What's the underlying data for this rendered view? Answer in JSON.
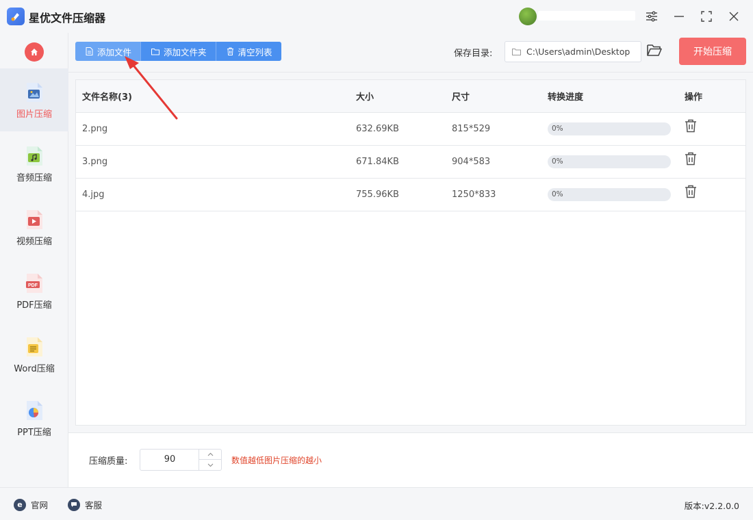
{
  "app": {
    "title": "星优文件压缩器"
  },
  "sidebar": {
    "items": [
      {
        "label": "图片压缩",
        "icon": "image-file-icon",
        "active": true
      },
      {
        "label": "音频压缩",
        "icon": "audio-file-icon",
        "active": false
      },
      {
        "label": "视频压缩",
        "icon": "video-file-icon",
        "active": false
      },
      {
        "label": "PDF压缩",
        "icon": "pdf-file-icon",
        "active": false
      },
      {
        "label": "Word压缩",
        "icon": "word-file-icon",
        "active": false
      },
      {
        "label": "PPT压缩",
        "icon": "ppt-file-icon",
        "active": false
      }
    ]
  },
  "toolbar": {
    "add_file": "添加文件",
    "add_folder": "添加文件夹",
    "clear_list": "清空列表",
    "save_dir_label": "保存目录:",
    "save_dir_value": "C:\\Users\\admin\\Desktop",
    "start_button": "开始压缩"
  },
  "table": {
    "headers": [
      "文件名称(3)",
      "大小",
      "尺寸",
      "转换进度",
      "操作"
    ],
    "rows": [
      {
        "name": "2.png",
        "size": "632.69KB",
        "dimensions": "815*529",
        "progress": 0,
        "progress_text": "0%"
      },
      {
        "name": "3.png",
        "size": "671.84KB",
        "dimensions": "904*583",
        "progress": 0,
        "progress_text": "0%"
      },
      {
        "name": "4.jpg",
        "size": "755.96KB",
        "dimensions": "1250*833",
        "progress": 0,
        "progress_text": "0%"
      }
    ]
  },
  "quality": {
    "label": "压缩质量:",
    "value": "90",
    "hint": "数值越低图片压缩的越小"
  },
  "statusbar": {
    "website": "官网",
    "support": "客服",
    "version": "版本:v2.2.0.0"
  },
  "colors": {
    "accent": "#4a90f0",
    "primary_red": "#f56c6c",
    "active_sidebar_text": "#f05a5a",
    "hint": "#e0452b",
    "arrow": "#e53935"
  }
}
